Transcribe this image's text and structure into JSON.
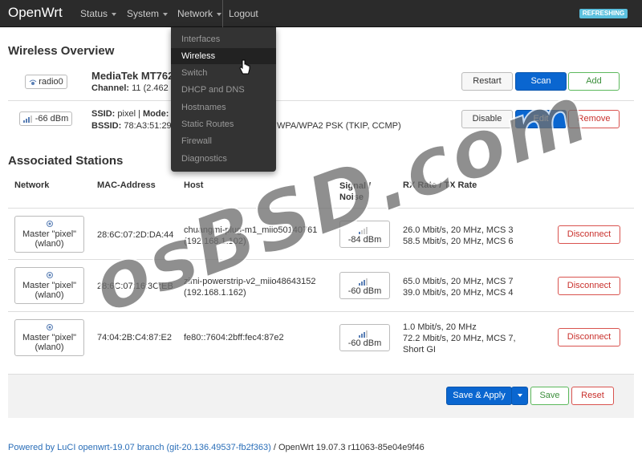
{
  "nav": {
    "brand": "OpenWrt",
    "items": [
      "Status",
      "System",
      "Network"
    ],
    "logout": "Logout",
    "badge": "REFRESHING"
  },
  "dropdown": {
    "items": [
      "Interfaces",
      "Wireless",
      "Switch",
      "DHCP and DNS",
      "Hostnames",
      "Static Routes",
      "Firewall",
      "Diagnostics"
    ],
    "active": "Wireless"
  },
  "overview": {
    "title": "Wireless Overview",
    "radio": {
      "badge": "radio0",
      "name": "MediaTek MT762",
      "channel_label": "Channel:",
      "channel_value": "11 (2.462 G",
      "buttons": [
        "Restart",
        "Scan",
        "Add"
      ]
    },
    "network": {
      "signal": "-66 dBm",
      "ssid_label": "SSID:",
      "ssid_value": "pixel |",
      "mode_label": "Mode:",
      "bssid_label": "BSSID:",
      "bssid_value": "78:A3:51:29:",
      "encryption": "WPA/WPA2 PSK (TKIP, CCMP)",
      "buttons": [
        "Disable",
        "Edit",
        "Remove"
      ]
    }
  },
  "stations": {
    "title": "Associated Stations",
    "headers": [
      "Network",
      "MAC-Address",
      "Host",
      "Signal / Noise",
      "RX Rate / TX Rate"
    ],
    "rows": [
      {
        "network": [
          "Master \"pixel\"",
          "(wlan0)"
        ],
        "mac": "28:6C:07:2D:DA:44",
        "host": [
          "chuangmi-plug-m1_miio50140761",
          "(192.168.1.102)"
        ],
        "signal": "-84 dBm",
        "rates": [
          "26.0 Mbit/s, 20 MHz, MCS 3",
          "58.5 Mbit/s, 20 MHz, MCS 6"
        ],
        "action": "Disconnect"
      },
      {
        "network": [
          "Master \"pixel\"",
          "(wlan0)"
        ],
        "mac": "28:6C:07:16:3C:EB",
        "host": [
          "zimi-powerstrip-v2_miio48643152",
          "(192.168.1.162)"
        ],
        "signal": "-60 dBm",
        "rates": [
          "65.0 Mbit/s, 20 MHz, MCS 7",
          "39.0 Mbit/s, 20 MHz, MCS 4"
        ],
        "action": "Disconnect"
      },
      {
        "network": [
          "Master \"pixel\"",
          "(wlan0)"
        ],
        "mac": "74:04:2B:C4:87:E2",
        "host": [
          "fe80::7604:2bff:fec4:87e2"
        ],
        "signal": "-60 dBm",
        "rates": [
          "1.0 Mbit/s, 20 MHz",
          "72.2 Mbit/s, 20 MHz, MCS 7,",
          "Short GI"
        ],
        "action": "Disconnect"
      }
    ]
  },
  "actions": {
    "save_apply": "Save & Apply",
    "save": "Save",
    "reset": "Reset"
  },
  "footer": {
    "link": "Powered by LuCI openwrt-19.07 branch (git-20.136.49537-fb2f363)",
    "version": "/ OpenWrt 19.07.3 r11063-85e04e9f46"
  },
  "watermark": "osBSD.com",
  "colors": {
    "primary": "#0a66d0",
    "navbar": "#2b2b2b",
    "badge": "#5bc0de",
    "danger": "#d9534f",
    "success": "#5cb85c"
  }
}
